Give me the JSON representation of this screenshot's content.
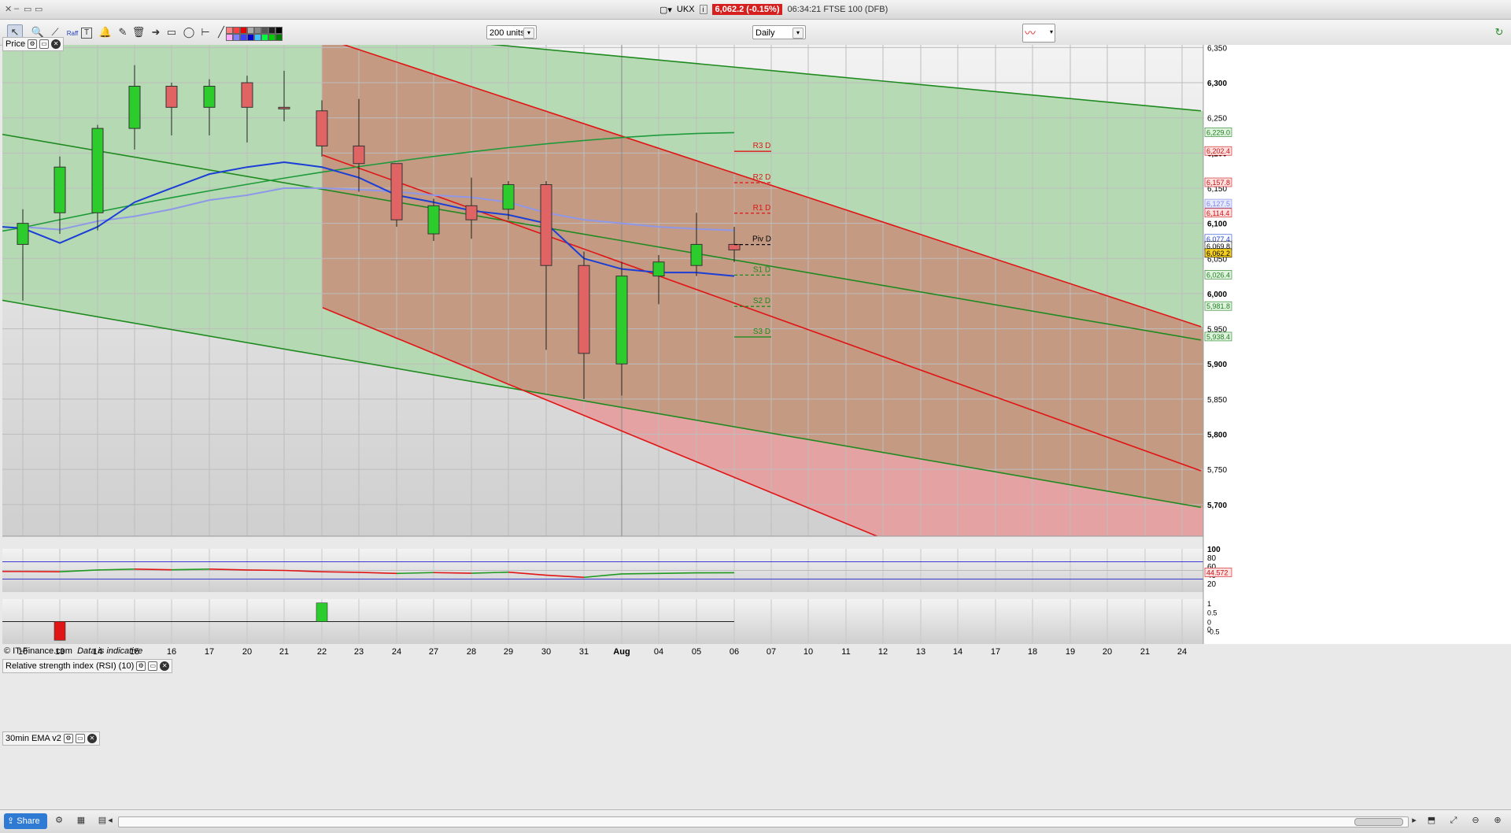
{
  "window": {
    "ticker_symbol": "UKX",
    "last_price": "6,062.2 (-0.15%)",
    "clock_and_name": "06:34:21 FTSE 100 (DFB)"
  },
  "toolbar": {
    "units_select": "200 units",
    "interval_select": "Daily",
    "text_tool": "T",
    "raff_tool": "Raff"
  },
  "panels": {
    "price_label": "Price",
    "rsi_label": "Relative strength index (RSI) (10)",
    "ema_label": "30min EMA v2"
  },
  "copyright": {
    "owner": "© IT-Finance.com",
    "note": "Data is indicative"
  },
  "statusbar": {
    "share_label": "Share"
  },
  "colors": {
    "bull": "#2dcc2d",
    "bear": "#e06464",
    "green_line": "#1f8a1f",
    "red_line": "#e01515",
    "ema_dark": "#1a3ed6",
    "ema_light": "#8f98e8",
    "green_fill": "#b2d9b0",
    "red_fill": "#c49a83",
    "pink_fill": "#e5a2a2"
  },
  "chart_data": {
    "type": "candlestick",
    "x_labels": [
      "10",
      "13",
      "14",
      "15",
      "16",
      "17",
      "20",
      "21",
      "22",
      "23",
      "24",
      "27",
      "28",
      "29",
      "30",
      "31",
      "Aug",
      "04",
      "05",
      "06",
      "07",
      "10",
      "11",
      "12",
      "13",
      "14",
      "17",
      "18",
      "19",
      "20",
      "21",
      "24"
    ],
    "ohlc": [
      {
        "x": "10",
        "o": 6070,
        "h": 6120,
        "l": 5990,
        "c": 6100
      },
      {
        "x": "13",
        "o": 6115,
        "h": 6195,
        "l": 6085,
        "c": 6180
      },
      {
        "x": "14",
        "o": 6115,
        "h": 6240,
        "l": 6090,
        "c": 6235
      },
      {
        "x": "15",
        "o": 6235,
        "h": 6325,
        "l": 6205,
        "c": 6295
      },
      {
        "x": "16",
        "o": 6295,
        "h": 6300,
        "l": 6225,
        "c": 6265
      },
      {
        "x": "17",
        "o": 6265,
        "h": 6305,
        "l": 6225,
        "c": 6295
      },
      {
        "x": "20",
        "o": 6300,
        "h": 6310,
        "l": 6215,
        "c": 6265
      },
      {
        "x": "21",
        "o": 6265,
        "h": 6317,
        "l": 6245,
        "c": 6263
      },
      {
        "x": "22",
        "o": 6260,
        "h": 6275,
        "l": 6195,
        "c": 6210
      },
      {
        "x": "23",
        "o": 6210,
        "h": 6277,
        "l": 6145,
        "c": 6185
      },
      {
        "x": "24",
        "o": 6185,
        "h": 6185,
        "l": 6095,
        "c": 6105
      },
      {
        "x": "27",
        "o": 6085,
        "h": 6135,
        "l": 6075,
        "c": 6125
      },
      {
        "x": "28",
        "o": 6125,
        "h": 6165,
        "l": 6078,
        "c": 6105
      },
      {
        "x": "29",
        "o": 6120,
        "h": 6160,
        "l": 6105,
        "c": 6155
      },
      {
        "x": "30",
        "o": 6155,
        "h": 6160,
        "l": 5920,
        "c": 6040
      },
      {
        "x": "31",
        "o": 6040,
        "h": 6060,
        "l": 5850,
        "c": 5915
      },
      {
        "x": "Aug",
        "o": 5900,
        "h": 6045,
        "l": 5855,
        "c": 6025
      },
      {
        "x": "04",
        "o": 6025,
        "h": 6055,
        "l": 5985,
        "c": 6045
      },
      {
        "x": "05",
        "o": 6040,
        "h": 6115,
        "l": 6025,
        "c": 6070
      },
      {
        "x": "06",
        "o": 6070,
        "h": 6095,
        "l": 6045,
        "c": 6062.2
      }
    ],
    "ema_fast": [
      6093,
      6072,
      6095,
      6130,
      6150,
      6170,
      6180,
      6187,
      6180,
      6165,
      6140,
      6130,
      6118,
      6112,
      6100,
      6050,
      6035,
      6030,
      6030,
      6025
    ],
    "ema_slow": [
      6095,
      6091,
      6103,
      6110,
      6120,
      6133,
      6140,
      6150,
      6150,
      6148,
      6145,
      6140,
      6137,
      6130,
      6115,
      6105,
      6100,
      6095,
      6092,
      6090
    ],
    "sma_long": {
      "x": [
        "10",
        "06"
      ],
      "y": [
        6094,
        6229
      ]
    },
    "pivots": [
      {
        "label": "R3 D",
        "value": 6202.4,
        "color": "red"
      },
      {
        "label": "R2 D",
        "value": 6157.8,
        "color": "red"
      },
      {
        "label": "R1 D",
        "value": 6114.4,
        "color": "red"
      },
      {
        "label": "Piv D",
        "value": 6069.8,
        "color": "black"
      },
      {
        "label": "S1 D",
        "value": 6026.4,
        "color": "green"
      },
      {
        "label": "S2 D",
        "value": 5981.8,
        "color": "green"
      },
      {
        "label": "S3 D",
        "value": 5938.4,
        "color": "green"
      }
    ],
    "price_tags": [
      {
        "value": 6229.0,
        "color": "green"
      },
      {
        "value": 6202.4,
        "color": "red"
      },
      {
        "value": 6157.8,
        "color": "red"
      },
      {
        "value": 6127.5,
        "color": "lightblue"
      },
      {
        "value": 6114.4,
        "color": "red"
      },
      {
        "value": 6077.4,
        "color": "blue"
      },
      {
        "value": 6069.8,
        "color": "black"
      },
      {
        "value": 6062.2,
        "color": "yellow"
      },
      {
        "value": 6026.4,
        "color": "green"
      },
      {
        "value": 5981.8,
        "color": "green"
      },
      {
        "value": 5938.4,
        "color": "green"
      }
    ],
    "y_ticks": [
      6350,
      6300,
      6250,
      6200,
      6150,
      6100,
      6050,
      6000,
      5950,
      5900,
      5850,
      5800,
      5750,
      5700
    ],
    "ylim": [
      5655,
      6365
    ],
    "rsi": {
      "values": [
        47.5,
        47,
        51,
        53,
        51.5,
        53,
        51,
        50,
        47,
        45.5,
        43,
        45,
        43.5,
        46,
        39,
        34,
        42,
        43,
        44.5,
        44.572
      ],
      "last_label": "44.572",
      "ticks": [
        "100",
        "80",
        "60",
        "40",
        "20"
      ],
      "levels": [
        70,
        30
      ],
      "ylim": [
        0,
        100
      ]
    },
    "ema_signal": {
      "values": [
        0,
        -1,
        0,
        0,
        0,
        0,
        0,
        0,
        1,
        0,
        0,
        0,
        0,
        0,
        0,
        0,
        0,
        0,
        0,
        0
      ],
      "ticks": [
        "1",
        "0.5",
        "0",
        "0",
        "-0.5"
      ],
      "ylim": [
        -1.2,
        1.2
      ]
    },
    "channels": {
      "green_outer_upper": {
        "x": [
          0,
          1526
        ],
        "y": [
          6420,
          6260
        ]
      },
      "green_outer_lower": {
        "x": [
          0,
          1526
        ],
        "y": [
          5991,
          5696
        ]
      },
      "green_inner": {
        "x": [
          0,
          1526
        ],
        "y": [
          6227,
          5934
        ]
      },
      "red_upper": {
        "x": [
          410,
          1526
        ],
        "y": [
          6364,
          5953
        ]
      },
      "red_inner": {
        "x": [
          410,
          1526
        ],
        "y": [
          6197,
          5748
        ]
      },
      "red_lower": {
        "x": [
          410,
          1526
        ],
        "y": [
          5980,
          5465
        ]
      }
    }
  }
}
